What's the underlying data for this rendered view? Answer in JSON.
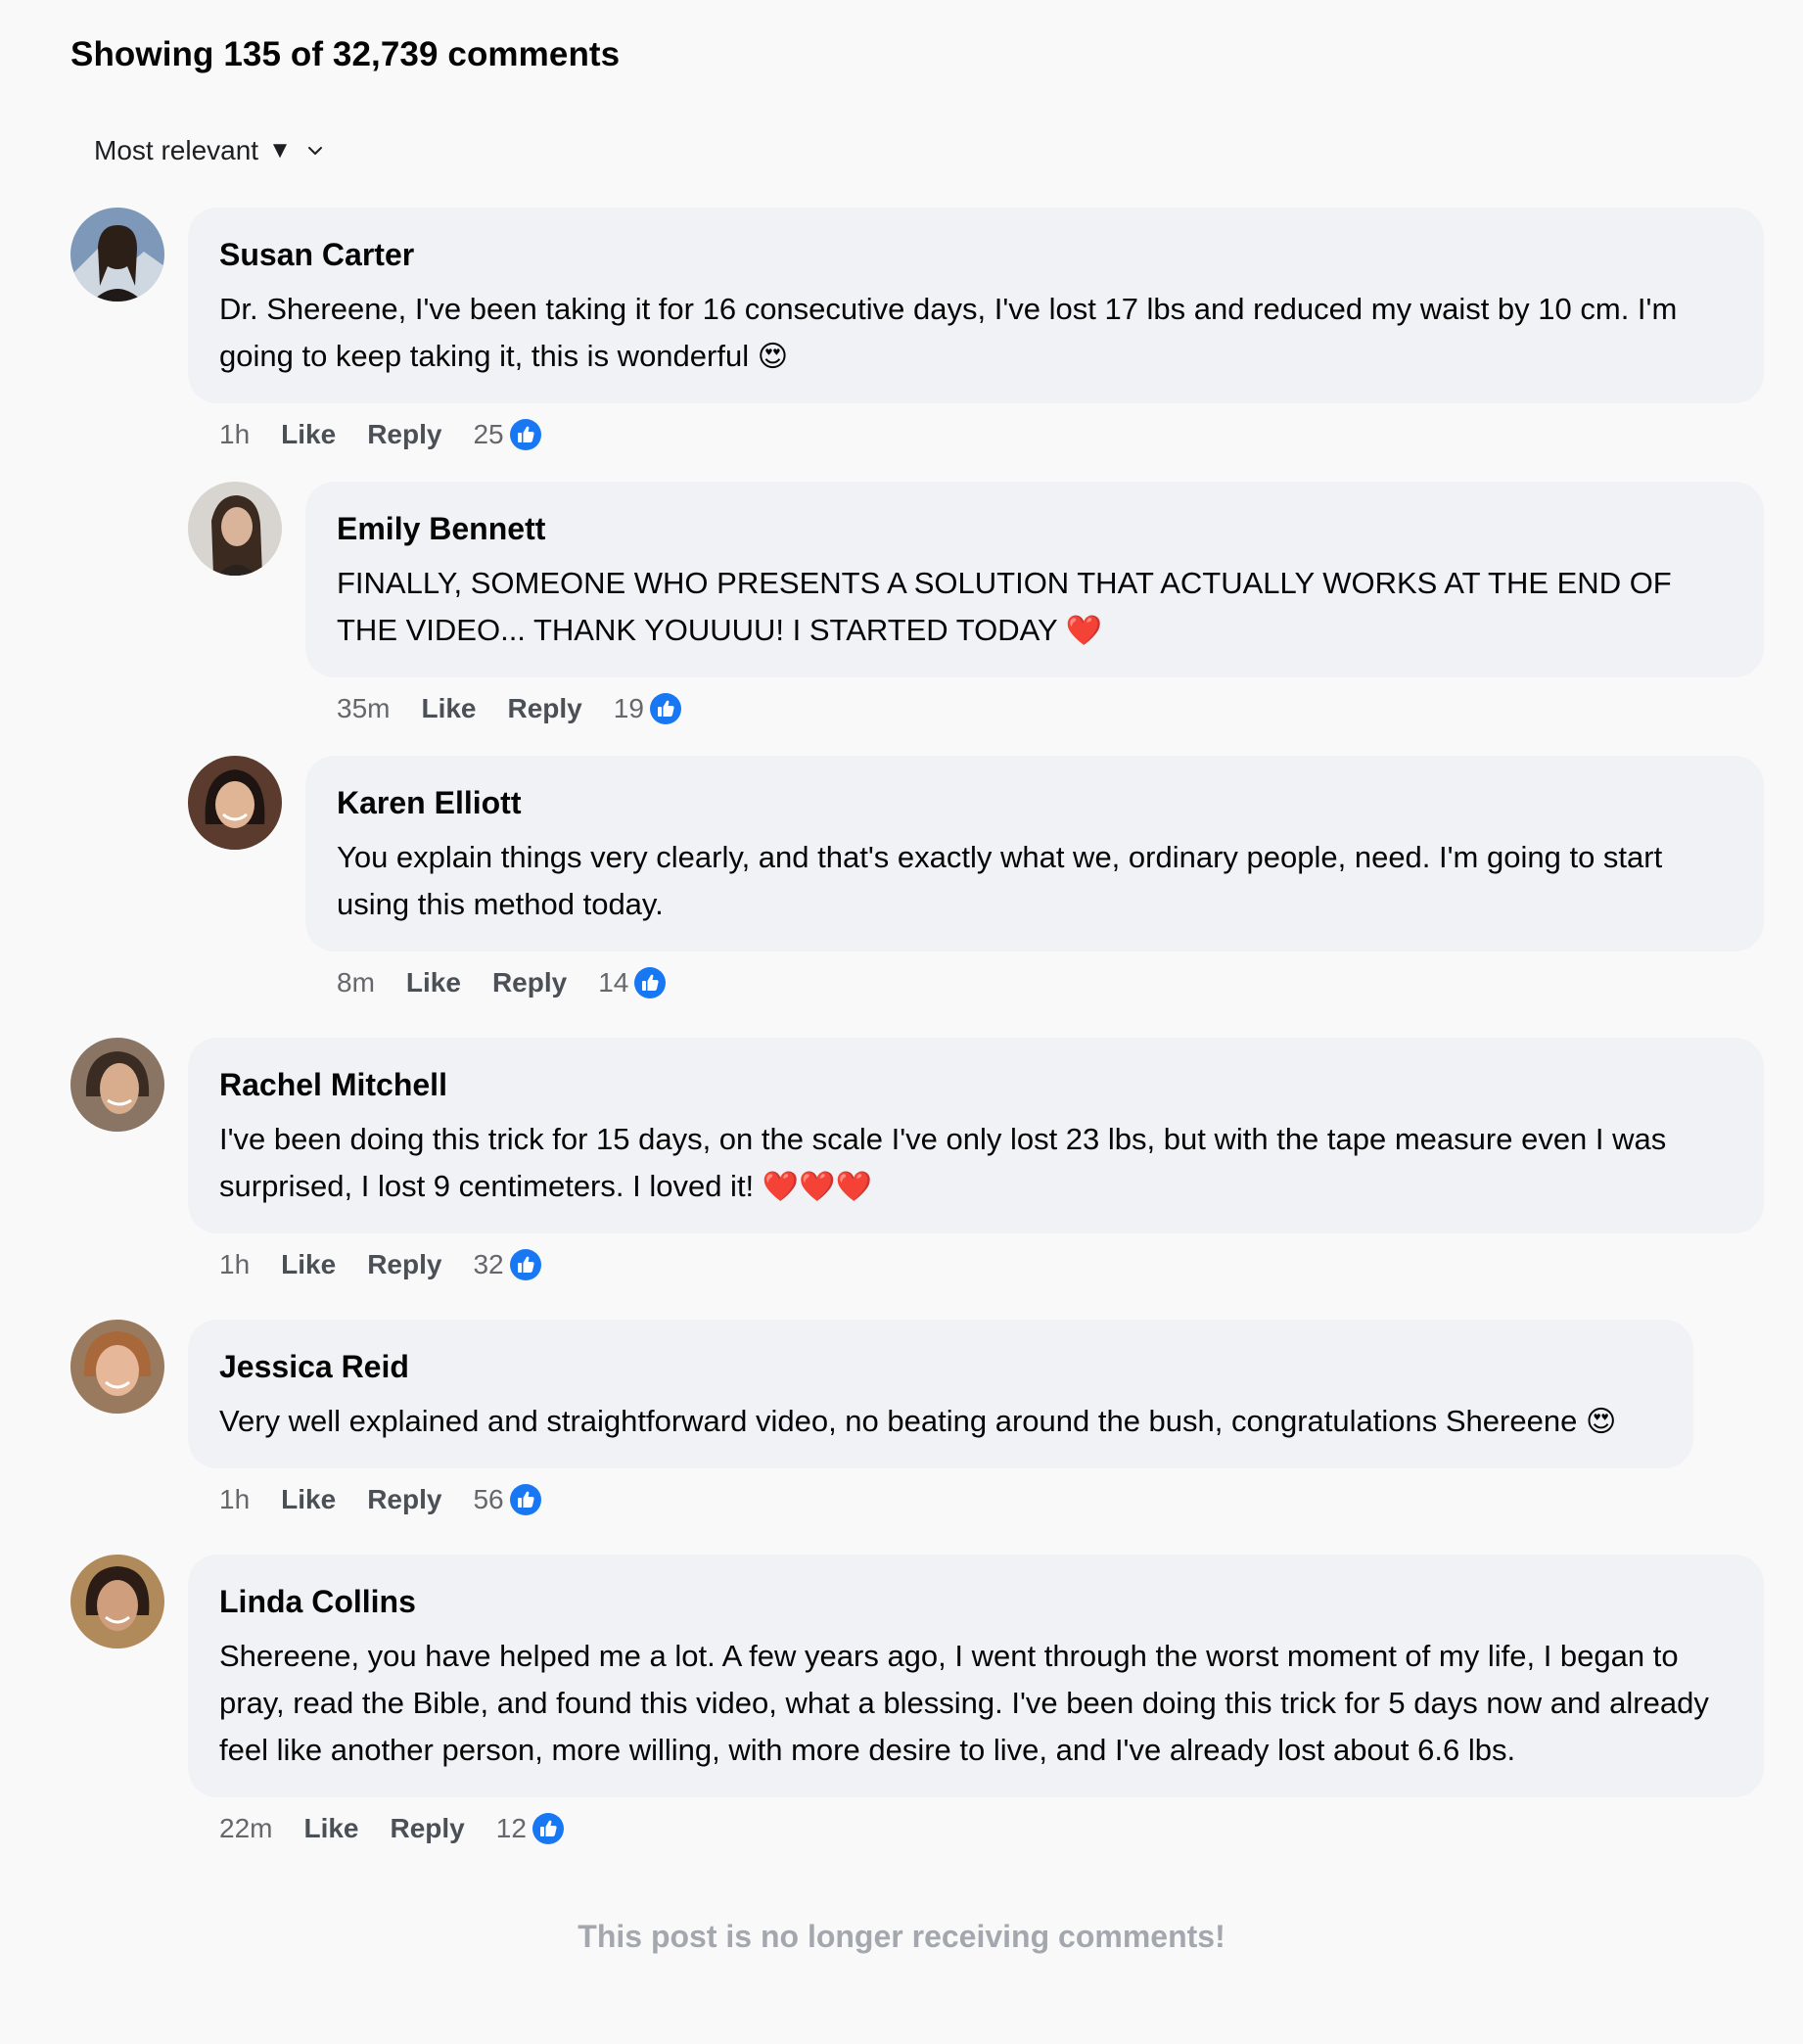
{
  "header": {
    "title": "Showing 135 of 32,739 comments",
    "sort_label": "Most relevant",
    "sort_triangle": "▼"
  },
  "actions": {
    "like_label": "Like",
    "reply_label": "Reply"
  },
  "comments": [
    {
      "author": "Susan Carter",
      "text": "Dr. Shereene, I've been taking it for 16 consecutive days, I've lost 17 lbs and reduced my waist by 10 cm. I'm going to keep taking it, this is wonderful",
      "emoji": "😍",
      "time": "1h",
      "likes": "25"
    },
    {
      "author": "Emily Bennett",
      "text": "FINALLY, SOMEONE WHO PRESENTS A SOLUTION THAT ACTUALLY WORKS AT THE END OF THE VIDEO... THANK YOUUUU! I STARTED TODAY",
      "emoji": "❤️",
      "time": "35m",
      "likes": "19"
    },
    {
      "author": "Karen Elliott",
      "text": "You explain things very clearly, and that's exactly what we, ordinary people, need. I'm going to start using this method today.",
      "emoji": "",
      "time": "8m",
      "likes": "14"
    },
    {
      "author": "Rachel Mitchell",
      "text": "I've been doing this trick for 15 days, on the scale I've only lost 23 lbs, but with the tape measure even I was surprised, I lost 9 centimeters. I loved it!",
      "emoji": "❤️❤️❤️",
      "time": "1h",
      "likes": "32"
    },
    {
      "author": "Jessica Reid",
      "text": "Very well explained and straightforward video, no beating around the bush, congratulations Shereene",
      "emoji": "😍",
      "time": "1h",
      "likes": "56"
    },
    {
      "author": "Linda Collins",
      "text": "Shereene, you have helped me a lot. A few years ago, I went through the worst moment of my life, I began to pray, read the Bible, and found this video, what a blessing. I've been doing this trick for 5 days now and already feel like another person, more willing, with more desire to live, and I've already lost about 6.6 lbs.",
      "emoji": "",
      "time": "22m",
      "likes": "12"
    }
  ],
  "footer": {
    "note": "This post is no longer receiving comments!"
  },
  "colors": {
    "background": "#f9f9fa",
    "bubble": "#f0f2f5",
    "like_blue": "#1877f2",
    "muted_text": "#65676b",
    "footer_text": "#a4a8ae"
  }
}
